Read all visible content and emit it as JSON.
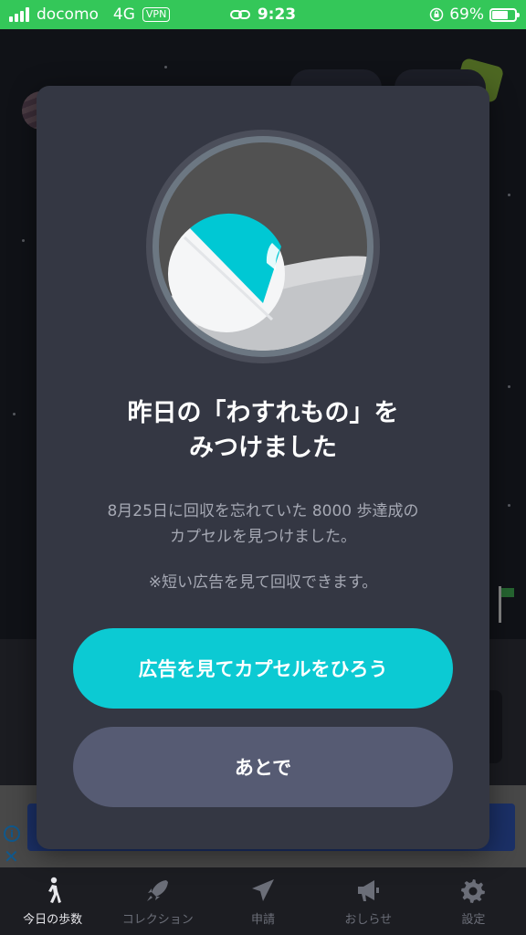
{
  "status_bar": {
    "carrier": "docomo",
    "network": "4G",
    "vpn": "VPN",
    "time": "9:23",
    "battery": "69%",
    "battery_level": 0.69
  },
  "dialog": {
    "title_line1": "昨日の「わすれもの」を",
    "title_line2": "みつけました",
    "description_line1": "8月25日に回収を忘れていた 8000 歩達成の",
    "description_line2": "カプセルを見つけました。",
    "note": "※短い広告を見て回収できます。",
    "primary_button": "広告を見てカプセルをひろう",
    "secondary_button": "あとで"
  },
  "tab_bar": {
    "items": [
      {
        "label": "今日の歩数",
        "icon": "walking-person-icon",
        "active": true
      },
      {
        "label": "コレクション",
        "icon": "rocket-icon",
        "active": false
      },
      {
        "label": "申請",
        "icon": "paper-plane-icon",
        "active": false
      },
      {
        "label": "おしらせ",
        "icon": "megaphone-icon",
        "active": false
      },
      {
        "label": "設定",
        "icon": "gear-icon",
        "active": false
      }
    ]
  },
  "ad": {
    "info_icon": "info-icon",
    "close_icon": "close-icon"
  },
  "colors": {
    "status_bar": "#34c759",
    "primary_button": "#0ccad3",
    "secondary_button": "#565b73",
    "dialog_bg": "#343743"
  }
}
